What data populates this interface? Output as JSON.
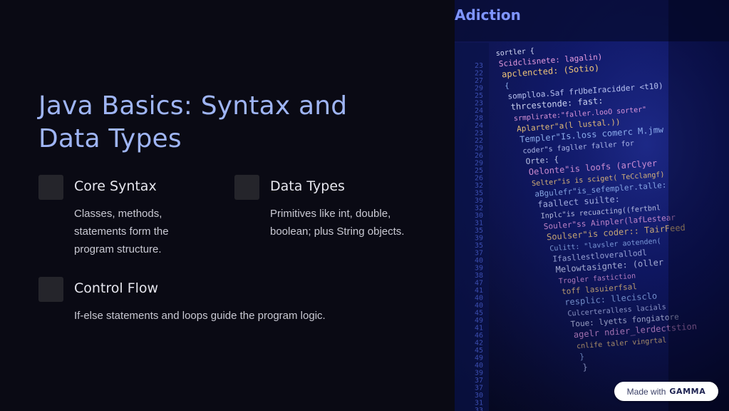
{
  "slide": {
    "title_line1": "Java Basics: Syntax and",
    "title_line2": "Data Types",
    "cards": [
      {
        "heading": "Core Syntax",
        "text": "Classes, methods, statements form the program structure."
      },
      {
        "heading": "Data Types",
        "text": "Primitives like int, double, boolean; plus String objects."
      },
      {
        "heading": "Control Flow",
        "text": "If-else statements and loops guide the program logic."
      }
    ]
  },
  "badge": {
    "prefix": "Made with",
    "brand": "GAMMA"
  },
  "colors": {
    "background": "#0a0a14",
    "title": "#9fb5f5",
    "card_box": "#25252b",
    "code_bg": "#0e1660"
  },
  "code_image": {
    "header": "Adiction",
    "line_numbers": [
      "23",
      "22",
      "27",
      "29",
      "25",
      "23",
      "24",
      "28",
      "24",
      "23",
      "22",
      "29",
      "26",
      "29",
      "25",
      "26",
      "32",
      "35",
      "39",
      "32",
      "30",
      "31",
      "35",
      "39",
      "35",
      "37",
      "40",
      "39",
      "38",
      "47",
      "41",
      "40",
      "40",
      "45",
      "49",
      "41",
      "46",
      "42",
      "45",
      "49",
      "40",
      "39",
      "37",
      "37",
      "30",
      "31",
      "33"
    ],
    "code_lines": [
      "sortler {",
      "Scidclisnete: lagalin)",
      "apclencted: (Sotio)",
      "{",
      "somplloa.Saf frUbeIracidder <t10)",
      "thrcestonde: fast:",
      "srmplirate:\"faller.looO sorter\"",
      "Aplarter\"a(l lustal.))",
      "Templer\"Is.loss comerc M.jmw",
      "coder\"s fagller faller for",
      "Orte: {",
      "Oelonte\"is loofs (arClyer",
      "Selter\"is is sciget( TeCclangf)",
      "aBgulefr\"is_sefempler.talle:",
      "faallect suilte:",
      "Inplc\"is recuacting((fertbnl",
      "Souler\"ss Ainpler(lafLestear",
      "Soulser\"is coder:: TairFeed",
      "Culitt: \"lavsler aotenden(",
      "Ifasllestloverallodl",
      "Melowtasignte: (oller",
      "Trogler fastiction",
      "toff lasuierfsal",
      "resplic: llecisclo",
      "Culcerteralless lacials",
      "Toue: lyetts fongiatore",
      "agelr ndier_lerdectstion",
      "cnlife taler vingrtal",
      "}",
      "}"
    ]
  }
}
